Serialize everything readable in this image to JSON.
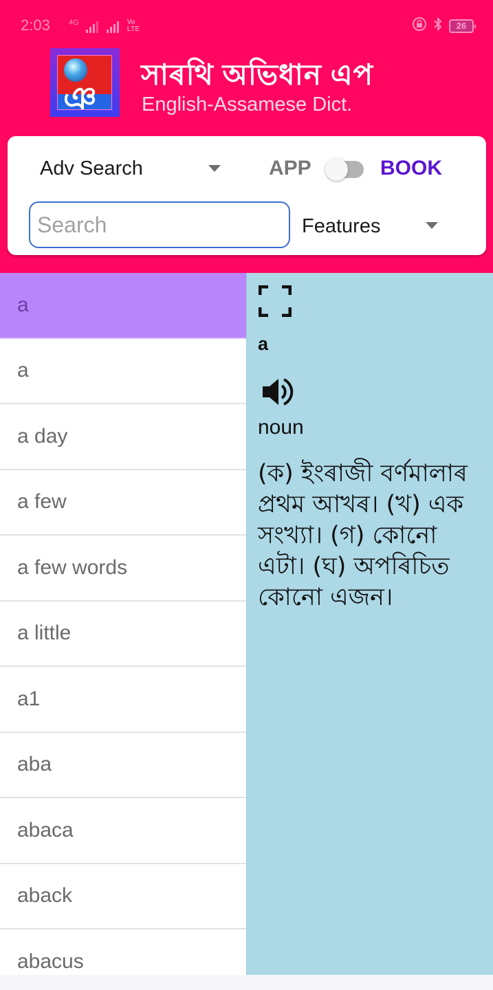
{
  "status_bar": {
    "time": "2:03",
    "network": "4G",
    "volte": "Vo LTE",
    "sim_slots": [
      "1",
      "2"
    ],
    "battery": "26",
    "icons": [
      "rotation-lock-icon",
      "bluetooth-icon",
      "battery-icon"
    ]
  },
  "header": {
    "app_title": "সাৰথি অভিধান এপ",
    "app_subtitle": "English-Assamese Dict.",
    "logo_icon": "app-logo-icon",
    "background_color": "#ff0660"
  },
  "controls": {
    "search_mode": "Adv Search",
    "toggle_left_label": "APP",
    "toggle_right_label": "BOOK",
    "toggle_state": "APP",
    "search_placeholder": "Search",
    "search_value": "",
    "features_label": "Features",
    "accent_color": "#5b14d0"
  },
  "word_list": {
    "selected_index": 0,
    "selected_color": "#b985fa",
    "items": [
      {
        "word": "a"
      },
      {
        "word": "a"
      },
      {
        "word": "a day"
      },
      {
        "word": "a few"
      },
      {
        "word": "a few words"
      },
      {
        "word": "a little"
      },
      {
        "word": "a1"
      },
      {
        "word": "aba"
      },
      {
        "word": "abaca"
      },
      {
        "word": "aback"
      },
      {
        "word": "abacus"
      }
    ]
  },
  "detail": {
    "background_color": "#add8e6",
    "fullscreen_icon": "fullscreen-icon",
    "word": "a",
    "speaker_icon": "speaker-icon",
    "part_of_speech": "noun",
    "definition": "(ক) ইংৰাজী বৰ্ণমালাৰ প্ৰথম আখৰ। (খ) এক সংখ্যা। (গ) কোনো এটা। (ঘ) অপৰিচিত কোনো এজন।"
  }
}
